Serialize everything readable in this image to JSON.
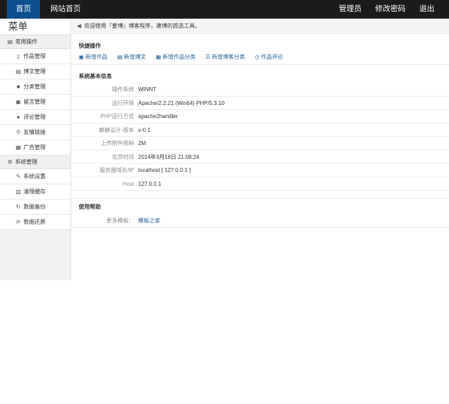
{
  "topbar": {
    "home": "首页",
    "site_home": "网站首页",
    "admin": "管理员",
    "change_password": "修改密码",
    "logout": "退出"
  },
  "sidebar": {
    "title": "菜单",
    "groups": [
      {
        "label": "常用操作",
        "items": [
          "作品管理",
          "博文管理",
          "分类管理",
          "留言管理",
          "评论管理",
          "友情链接",
          "广告管理"
        ]
      },
      {
        "label": "系统管理",
        "items": [
          "系统设置",
          "清理缓存",
          "数据备份",
          "数据还原"
        ]
      }
    ]
  },
  "welcome": "欢迎使用『姜博』博客程序，建博的首选工具。",
  "quick": {
    "title": "快捷操作",
    "links": [
      "新增作品",
      "新增博文",
      "新增作品分类",
      "新增博客分类",
      "作品评论"
    ]
  },
  "system": {
    "title": "系统基本信息",
    "rows": [
      {
        "key": "操作系统",
        "value": "WINNT"
      },
      {
        "key": "运行环境",
        "value": "Apache/2.2.21 (Win64) PHP/5.3.10"
      },
      {
        "key": "PHP运行方式",
        "value": "apache2handler"
      },
      {
        "key": "静静设计-版本",
        "value": "v-0.1"
      },
      {
        "key": "上传附件限制",
        "value": "2M"
      },
      {
        "key": "北京时间",
        "value": "2014年3月18日 21:08:24"
      },
      {
        "key": "服务器域名/IP",
        "value": "localhost [ 127.0.0.1 ]"
      },
      {
        "key": "Host",
        "value": "127.0.0.1"
      }
    ]
  },
  "help": {
    "title": "使用帮助",
    "key": "更多模板：",
    "value": "模板之家"
  }
}
